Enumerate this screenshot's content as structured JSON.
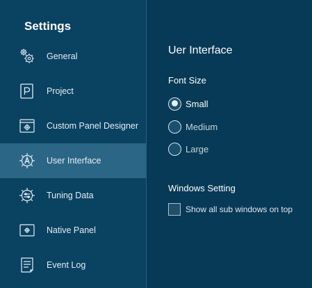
{
  "sidebar": {
    "title": "Settings",
    "items": [
      {
        "label": "General",
        "icon": "gears-icon",
        "selected": false
      },
      {
        "label": "Project",
        "icon": "project-p-icon",
        "selected": false
      },
      {
        "label": "Custom Panel Designer",
        "icon": "panel-designer-icon",
        "selected": false
      },
      {
        "label": "User Interface",
        "icon": "user-interface-gear-icon",
        "selected": true
      },
      {
        "label": "Tuning Data",
        "icon": "tuning-gear-icon",
        "selected": false
      },
      {
        "label": "Native Panel",
        "icon": "native-panel-icon",
        "selected": false
      },
      {
        "label": "Event Log",
        "icon": "event-log-icon",
        "selected": false
      }
    ]
  },
  "main": {
    "title": "Uer Interface",
    "font_size": {
      "label": "Font Size",
      "options": [
        {
          "label": "Small",
          "checked": true
        },
        {
          "label": "Medium",
          "checked": false
        },
        {
          "label": "Large",
          "checked": false
        }
      ]
    },
    "windows_setting": {
      "label": "Windows Setting",
      "checkbox_label": "Show all sub windows on top",
      "checked": false
    }
  },
  "colors": {
    "sidebar_bg": "#0a4262",
    "main_bg": "#063a56",
    "selected_bg": "#2b6687",
    "text": "#ffffff"
  }
}
